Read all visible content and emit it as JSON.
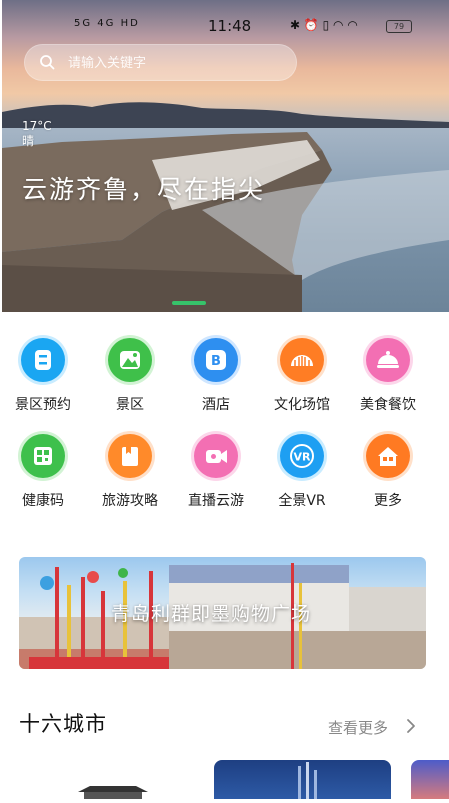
{
  "status_bar": {
    "time": "11:48",
    "network_left": "5G  4G  HD",
    "battery": "79"
  },
  "search": {
    "placeholder": "请输入关键字"
  },
  "hero": {
    "temperature": "17°C",
    "weather": "晴",
    "slogan": "云游齐鲁，尽在指尖"
  },
  "menu": [
    {
      "label": "景区预约",
      "icon": "ticket-icon",
      "color": "#1aa6f2"
    },
    {
      "label": "景区",
      "icon": "scenic-icon",
      "color": "#3fc04a"
    },
    {
      "label": "酒店",
      "icon": "hotel-icon",
      "color": "#2e8ff0"
    },
    {
      "label": "文化场馆",
      "icon": "venue-icon",
      "color": "#ff7d24"
    },
    {
      "label": "美食餐饮",
      "icon": "food-icon",
      "color": "#f36fb3"
    },
    {
      "label": "健康码",
      "icon": "qrcode-icon",
      "color": "#3ec04c"
    },
    {
      "label": "旅游攻略",
      "icon": "guide-icon",
      "color": "#ff8a2a"
    },
    {
      "label": "直播云游",
      "icon": "live-icon",
      "color": "#f36fb3"
    },
    {
      "label": "全景VR",
      "icon": "vr-icon",
      "color": "#1e9ff2"
    },
    {
      "label": "更多",
      "icon": "more-icon",
      "color": "#ff7a22"
    }
  ],
  "banner": {
    "title": "青岛利群即墨购物广场"
  },
  "cities": {
    "title": "十六城市",
    "more_label": "查看更多"
  }
}
